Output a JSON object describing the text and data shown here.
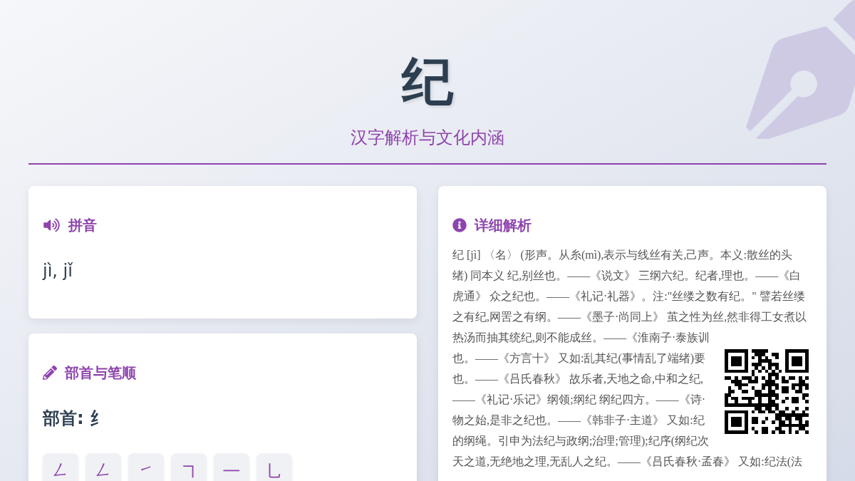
{
  "header": {
    "title": "纪",
    "subtitle": "汉字解析与文化内涵"
  },
  "pinyin_card": {
    "heading": "拼音",
    "pinyin": "jì, jǐ"
  },
  "radical_card": {
    "heading": "部首与笔顺",
    "radical": "部首: 纟",
    "strokes": [
      "㇜",
      "㇜",
      "㇀",
      "㇕",
      "㇐",
      "㇟"
    ]
  },
  "detail_card": {
    "heading": "详细解析",
    "lines": [
      "纪 [jì] 〈名〉 (形声。从糸(mì),表示与线丝有关,己声。本义:散丝的头",
      "绪) 同本义 纪,别丝也。——《说文》 三纲六纪。纪者,理也。——《白",
      "虎通》 众之纪也。——《礼记·礼器》。注:\"丝缕之数有纪。\" 譬若丝缕",
      "之有纪,网罟之有纲。——《墨子·尚同上》 茧之性为丝,然非得工女煮以",
      "热汤而抽其统纪,则不能成丝。——《淮南子·泰族训",
      "也。——《方言十》 又如:乱其纪(事情乱了端绪)要",
      "也。——《吕氏春秋》 故乐者,天地之命,中和之纪,",
      "——《礼记·乐记》纲领;纲纪 纲纪四方。——《诗·",
      "物之始,是非之纪也。——《韩非子·主道》 又如:纪",
      "的纲绳。引申为法纪与政纲;治理;管理);纪序(纲纪次",
      "天之道,无绝地之理,无乱人之纪。——《吕氏春秋·孟春》 又如:纪法(法"
    ]
  }
}
